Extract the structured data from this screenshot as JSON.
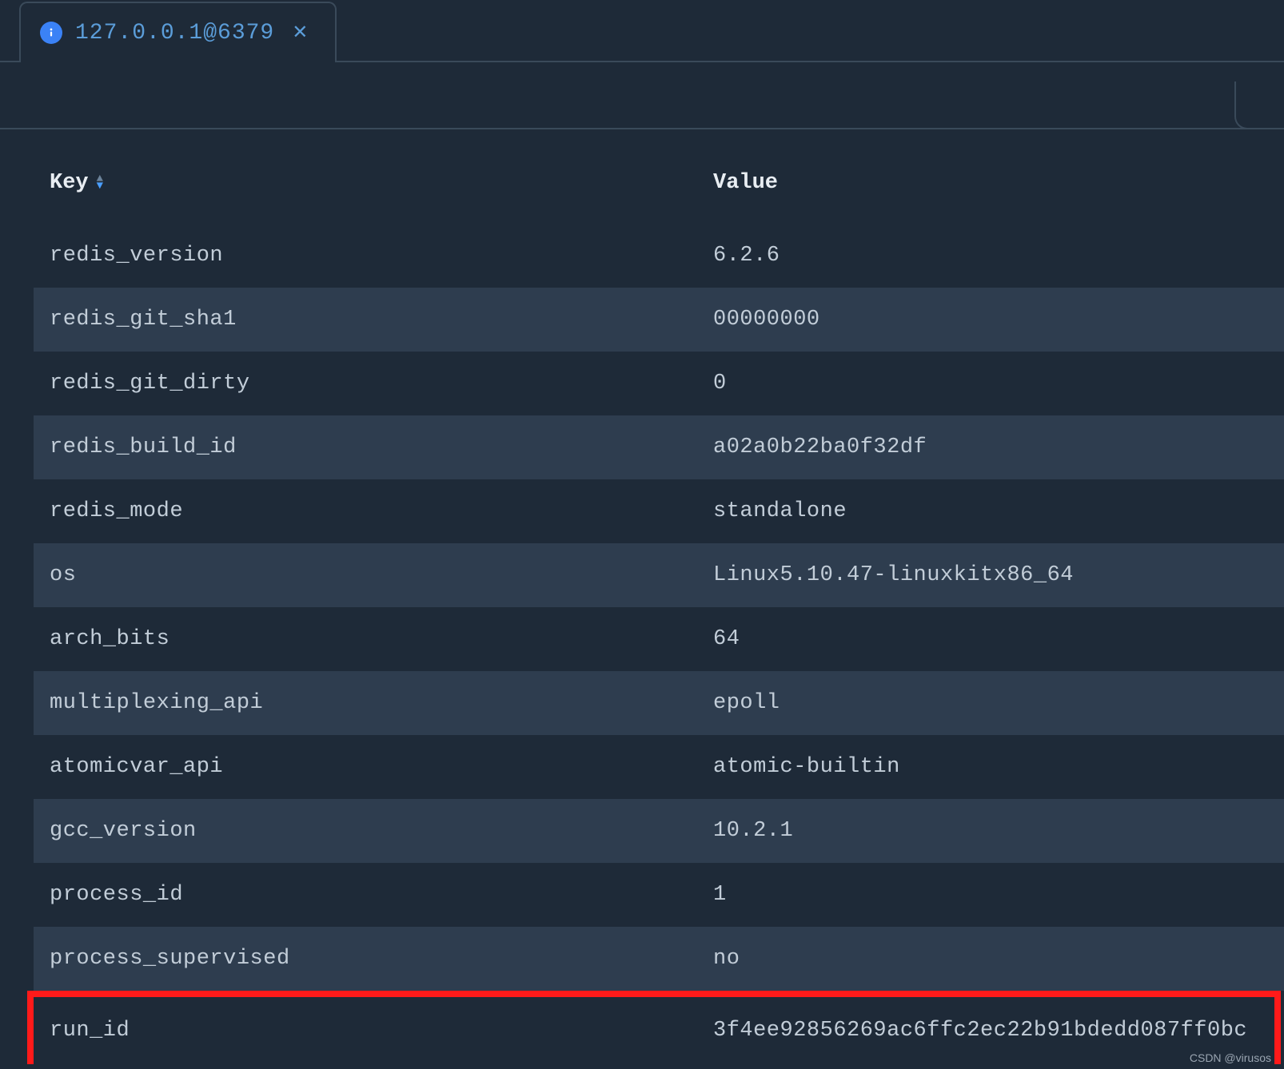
{
  "tab": {
    "label": "127.0.0.1@6379"
  },
  "table": {
    "headers": {
      "key": "Key",
      "value": "Value"
    },
    "rows": [
      {
        "key": "redis_version",
        "value": "6.2.6"
      },
      {
        "key": "redis_git_sha1",
        "value": "00000000"
      },
      {
        "key": "redis_git_dirty",
        "value": "0"
      },
      {
        "key": "redis_build_id",
        "value": "a02a0b22ba0f32df"
      },
      {
        "key": "redis_mode",
        "value": "standalone"
      },
      {
        "key": "os",
        "value": "Linux5.10.47-linuxkitx86_64"
      },
      {
        "key": "arch_bits",
        "value": "64"
      },
      {
        "key": "multiplexing_api",
        "value": "epoll"
      },
      {
        "key": "atomicvar_api",
        "value": "atomic-builtin"
      },
      {
        "key": "gcc_version",
        "value": "10.2.1"
      },
      {
        "key": "process_id",
        "value": "1"
      },
      {
        "key": "process_supervised",
        "value": "no"
      },
      {
        "key": "run_id",
        "value": "3f4ee92856269ac6ffc2ec22b91bdedd087ff0bc"
      }
    ]
  },
  "highlight_index": 12,
  "watermark": "CSDN @virusos"
}
